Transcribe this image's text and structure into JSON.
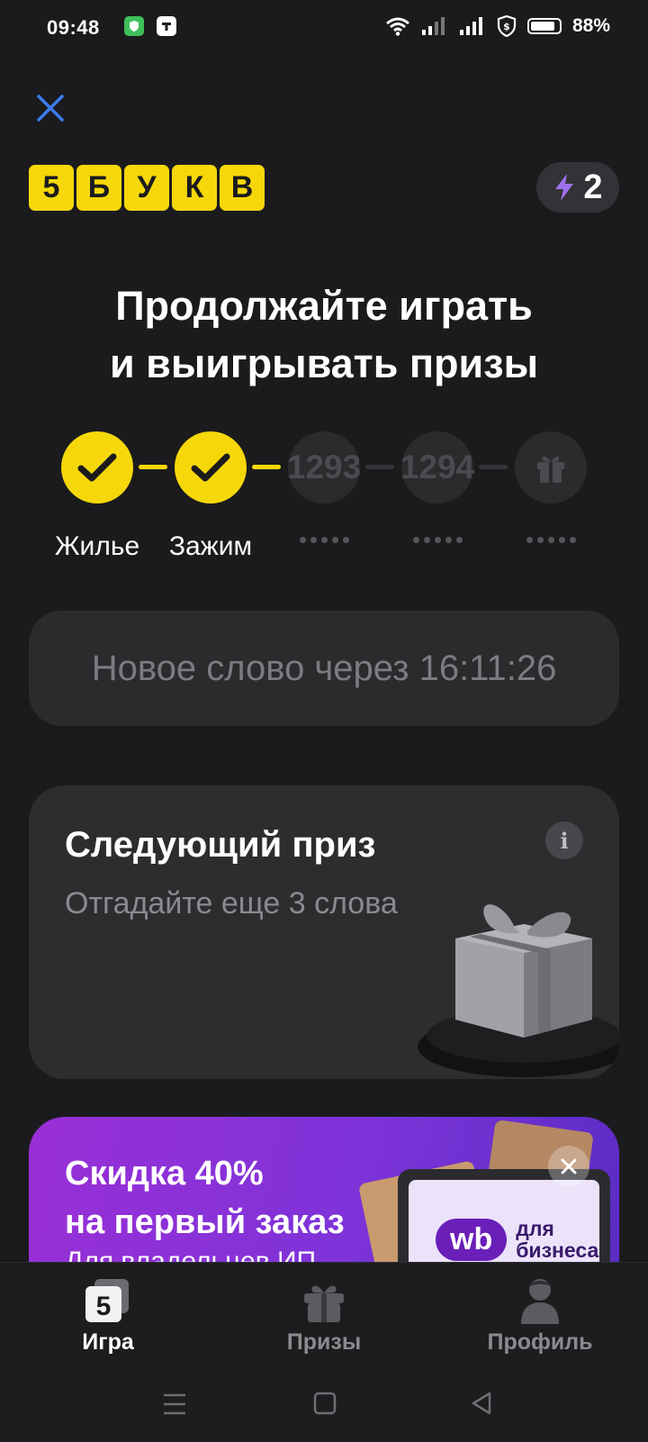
{
  "status_bar": {
    "time": "09:48",
    "battery": "88%",
    "battery_level": 0.88
  },
  "header": {
    "logo_letters": [
      "5",
      "Б",
      "У",
      "К",
      "В"
    ],
    "energy_count": "2"
  },
  "headline": {
    "line1": "Продолжайте играть",
    "line2": "и выигрывать призы"
  },
  "progress": {
    "steps": [
      {
        "state": "done",
        "label": "Жилье"
      },
      {
        "state": "done",
        "label": "Зажим"
      },
      {
        "state": "todo",
        "number": "1293"
      },
      {
        "state": "todo",
        "number": "1294"
      },
      {
        "state": "gift"
      }
    ]
  },
  "timer": {
    "text": "Новое слово через 16:11:26"
  },
  "prize_card": {
    "title": "Следующий приз",
    "subtitle": "Отгадайте еще 3 слова"
  },
  "promo": {
    "line1": "Скидка 40%",
    "line2": "на первый заказ",
    "partial_text": "Для владельцев ИП",
    "brand_logo": "wb",
    "brand_line1": "для",
    "brand_line2": "бизнеса"
  },
  "bottom_nav": {
    "items": [
      {
        "label": "Игра",
        "icon_glyph": "5",
        "active": true
      },
      {
        "label": "Призы",
        "active": false
      },
      {
        "label": "Профиль",
        "active": false
      }
    ]
  },
  "colors": {
    "background": "#1b1b1d",
    "accent_yellow": "#f6d80a",
    "card": "#2d2d30",
    "promo_purple": "#8a30d8"
  }
}
